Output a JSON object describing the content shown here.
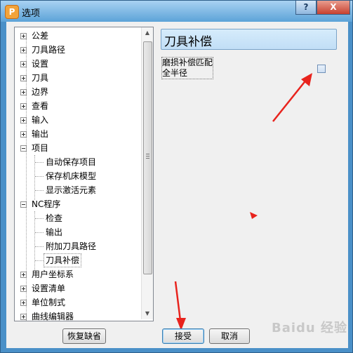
{
  "window": {
    "title": "选项",
    "app_icon_letter": "P",
    "help_label": "?",
    "close_label": "X"
  },
  "tree": {
    "items": [
      {
        "label": "公差"
      },
      {
        "label": "刀具路径"
      },
      {
        "label": "设置"
      },
      {
        "label": "刀具"
      },
      {
        "label": "边界"
      },
      {
        "label": "查看"
      },
      {
        "label": "输入"
      },
      {
        "label": "输出"
      },
      {
        "label": "项目"
      },
      {
        "label": "自动保存项目"
      },
      {
        "label": "保存机床模型"
      },
      {
        "label": "显示激活元素"
      },
      {
        "label": "NC程序"
      },
      {
        "label": "检查"
      },
      {
        "label": "输出"
      },
      {
        "label": "附加刀具路径"
      },
      {
        "label": "刀具补偿"
      },
      {
        "label": "用户坐标系"
      },
      {
        "label": "设置清单"
      },
      {
        "label": "单位制式"
      },
      {
        "label": "曲线编辑器"
      }
    ]
  },
  "panel": {
    "title": "刀具补偿",
    "option_label": "磨损补偿匹配全半径",
    "option_checked": false
  },
  "buttons": {
    "restore_defaults": "恢复缺省",
    "accept": "接受",
    "cancel": "取消"
  },
  "watermark": "Baidu 经验",
  "colors": {
    "titlebar": "#5ca3d8",
    "annotation_red": "#e8231d",
    "header_bg": "#c1def6"
  }
}
